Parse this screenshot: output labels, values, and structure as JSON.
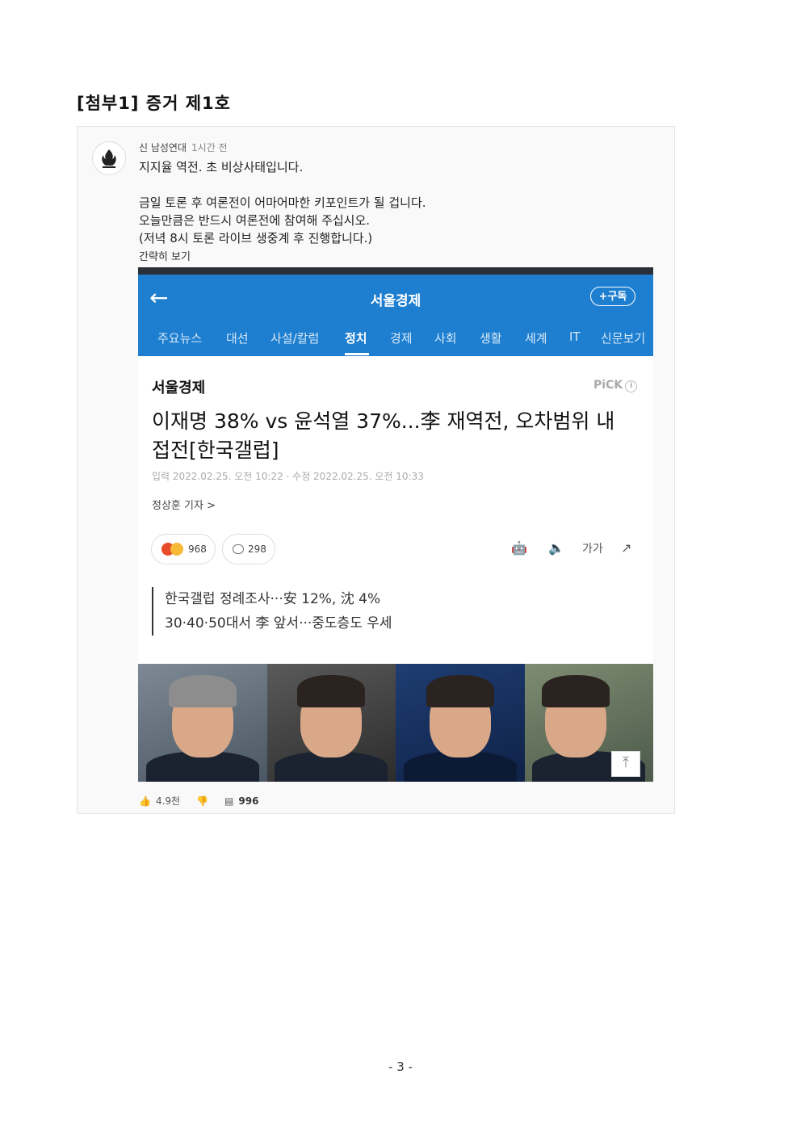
{
  "doc": {
    "title": "[첨부1] 증거 제1호",
    "page_number": "- 3 -"
  },
  "post": {
    "author": "신 남성연대",
    "time": "1시간 전",
    "lines": [
      "지지율 역전. 초 비상사태입니다.",
      "금일 토론 후 여론전이 어마어마한 키포인트가 될 겁니다.",
      "오늘만큼은 반드시 여론전에 참여해 주십시오.",
      "(저녁 8시 토론 라이브 생중계 후 진행합니다.)"
    ],
    "see_short": "간략히 보기",
    "likes": "4.9천",
    "comments": "996"
  },
  "article": {
    "app_name": "서울경제",
    "subscribe_label": "+구독",
    "tabs": [
      "주요뉴스",
      "대선",
      "사설/칼럼",
      "정치",
      "경제",
      "사회",
      "생활",
      "세계",
      "IT",
      "신문보기"
    ],
    "active_tab": "정치",
    "press": "서울경제",
    "pick": "PiCK",
    "headline_line1": "이재명 38% vs 윤석열 37%...李 재역전, 오차범위 내",
    "headline_line2": "접전[한국갤럽]",
    "dates": "입력 2022.02.25. 오전 10:22 · 수정 2022.02.25. 오전 10:33",
    "reporter": "정상훈 기자 >",
    "reactions": "968",
    "comment_count": "298",
    "font_size_label": "가가",
    "summary1": "한국갤럽 정례조사···安 12%, 沈 4%",
    "summary2": "30·40·50대서 李 앞서···중도층도 우세"
  },
  "colors": {
    "appbar": "#1e7fd0",
    "text": "#222222"
  }
}
